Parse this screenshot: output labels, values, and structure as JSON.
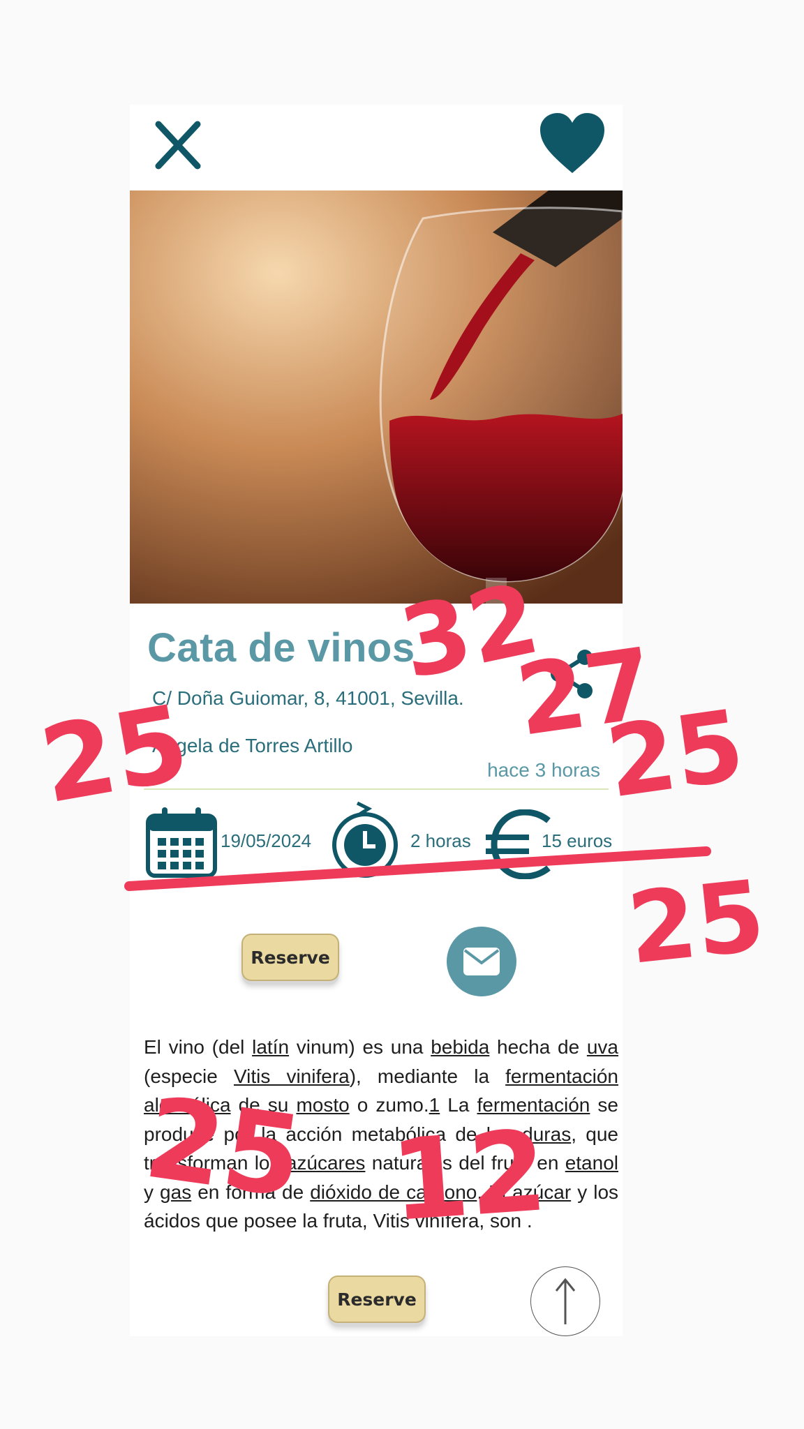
{
  "event": {
    "title": "Cata de vinos",
    "address": "C/ Doña Guiomar, 8, 41001, Sevilla.",
    "organizer": "Angela de Torres Artillo",
    "posted_ago": "hace 3 horas"
  },
  "details": {
    "date": "19/05/2024",
    "duration": "2 horas",
    "price": "15 euros"
  },
  "actions": {
    "reserve_label": "Reserve"
  },
  "description": {
    "seg0": "El vino (del ",
    "link_latin": "latín",
    "seg1": " vinum) es una ",
    "link_bebida": "bebida",
    "seg2": " hecha de ",
    "link_uva": "uva",
    "seg3": " (especie ",
    "link_vitis": "Vitis vinifera",
    "seg4": "), mediante la ",
    "link_fermentacion_alcoholica": "fermentación alcohólica",
    "seg5": " de su ",
    "link_mosto": "mosto",
    "seg6": " o zumo.",
    "link_ref1": "1",
    "seg7": " La ",
    "link_fermentacion": "fermentación",
    "seg8": " se produce por la acción metabólica de ",
    "link_levaduras": "levaduras",
    "seg9": ", que transforman los ",
    "link_azucares": "azúcares",
    "seg10": " naturales del fruto en ",
    "link_etanol": "etanol",
    "seg11": " y ",
    "link_gas": "gas",
    "seg12": " en forma de ",
    "link_co2": "dióxido de carbono",
    "seg13": ". El ",
    "link_azucar": "azúcar",
    "seg14": " y los ácidos que posee la fruta, Vitis vinífera, son ."
  },
  "annotations": [
    "32",
    "27",
    "25",
    "25",
    "25",
    "25",
    "12"
  ],
  "colors": {
    "teal_dark": "#0f5666",
    "teal_light": "#5a98a6",
    "button_gold": "#ead9a0",
    "annotation_red": "#ef3b5a"
  },
  "icons": [
    "close-icon",
    "heart-icon",
    "share-icon",
    "calendar-icon",
    "clock-icon",
    "euro-icon",
    "mail-icon",
    "arrow-up-icon"
  ]
}
